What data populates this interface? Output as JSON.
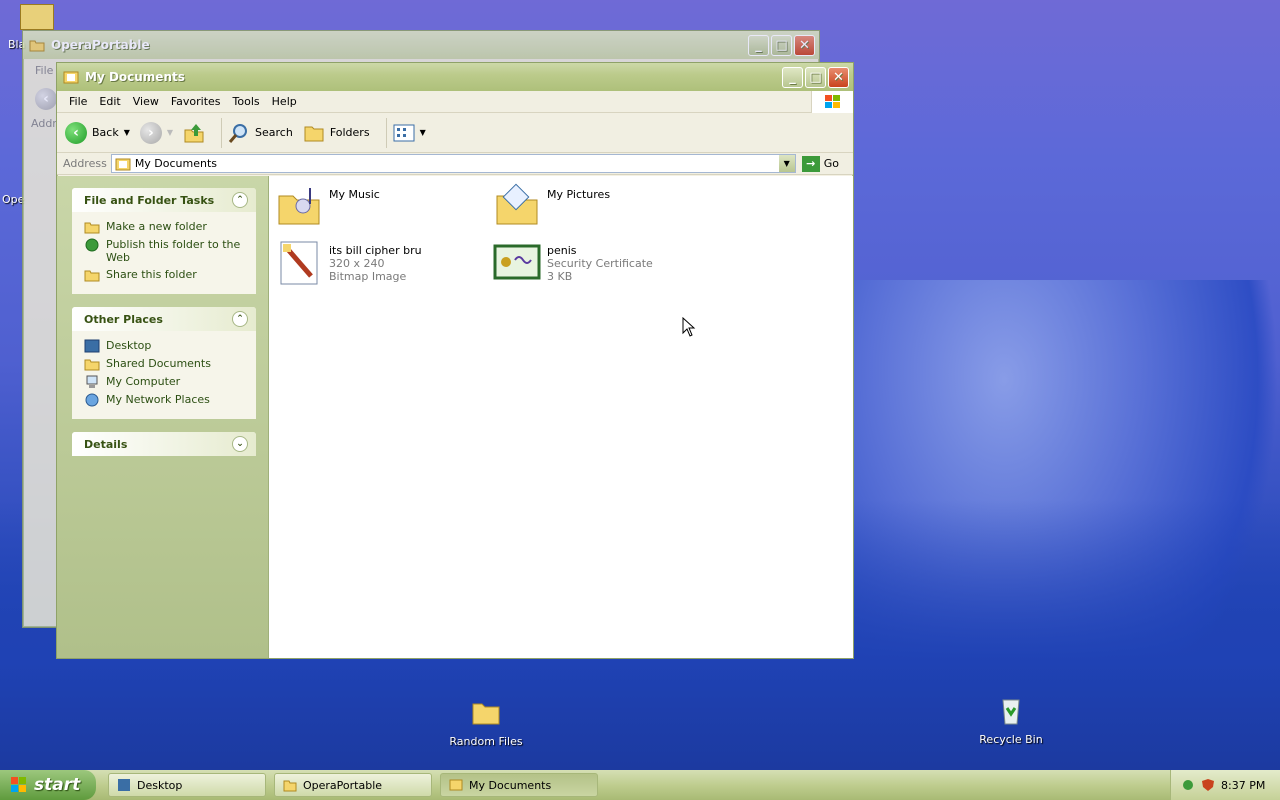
{
  "desktop": {
    "icons": [
      {
        "label": "Random Files",
        "icon": "folder-icon"
      },
      {
        "label": "Recycle Bin",
        "icon": "recycle-bin-icon"
      }
    ],
    "partial_labels": [
      "Bla",
      "Ope"
    ]
  },
  "back_window": {
    "title": "OperaPortable",
    "menu_first": "File",
    "addr_label": "Addr"
  },
  "window": {
    "title": "My Documents",
    "menu": [
      "File",
      "Edit",
      "View",
      "Favorites",
      "Tools",
      "Help"
    ],
    "toolbar": {
      "back": "Back",
      "search": "Search",
      "folders": "Folders"
    },
    "address": {
      "label": "Address",
      "value": "My Documents",
      "go": "Go"
    },
    "sidebar": {
      "tasks": {
        "title": "File and Folder Tasks",
        "items": [
          "Make a new folder",
          "Publish this folder to the Web",
          "Share this folder"
        ]
      },
      "places": {
        "title": "Other Places",
        "items": [
          "Desktop",
          "Shared Documents",
          "My Computer",
          "My Network Places"
        ]
      },
      "details": {
        "title": "Details"
      }
    },
    "files": [
      {
        "name": "My Music",
        "line2": "",
        "line3": "",
        "icon": "music-folder-icon"
      },
      {
        "name": "My Pictures",
        "line2": "",
        "line3": "",
        "icon": "pictures-folder-icon"
      },
      {
        "name": "its bill cipher bru",
        "line2": "320 x 240",
        "line3": "Bitmap Image",
        "icon": "bitmap-icon"
      },
      {
        "name": "penis",
        "line2": "Security Certificate",
        "line3": "3 KB",
        "icon": "certificate-icon"
      }
    ]
  },
  "taskbar": {
    "start": "start",
    "tasks": [
      "Desktop",
      "OperaPortable",
      "My Documents"
    ],
    "clock": "8:37 PM"
  },
  "colors": {
    "accent": "#aec07a",
    "link": "#2c4f13"
  }
}
